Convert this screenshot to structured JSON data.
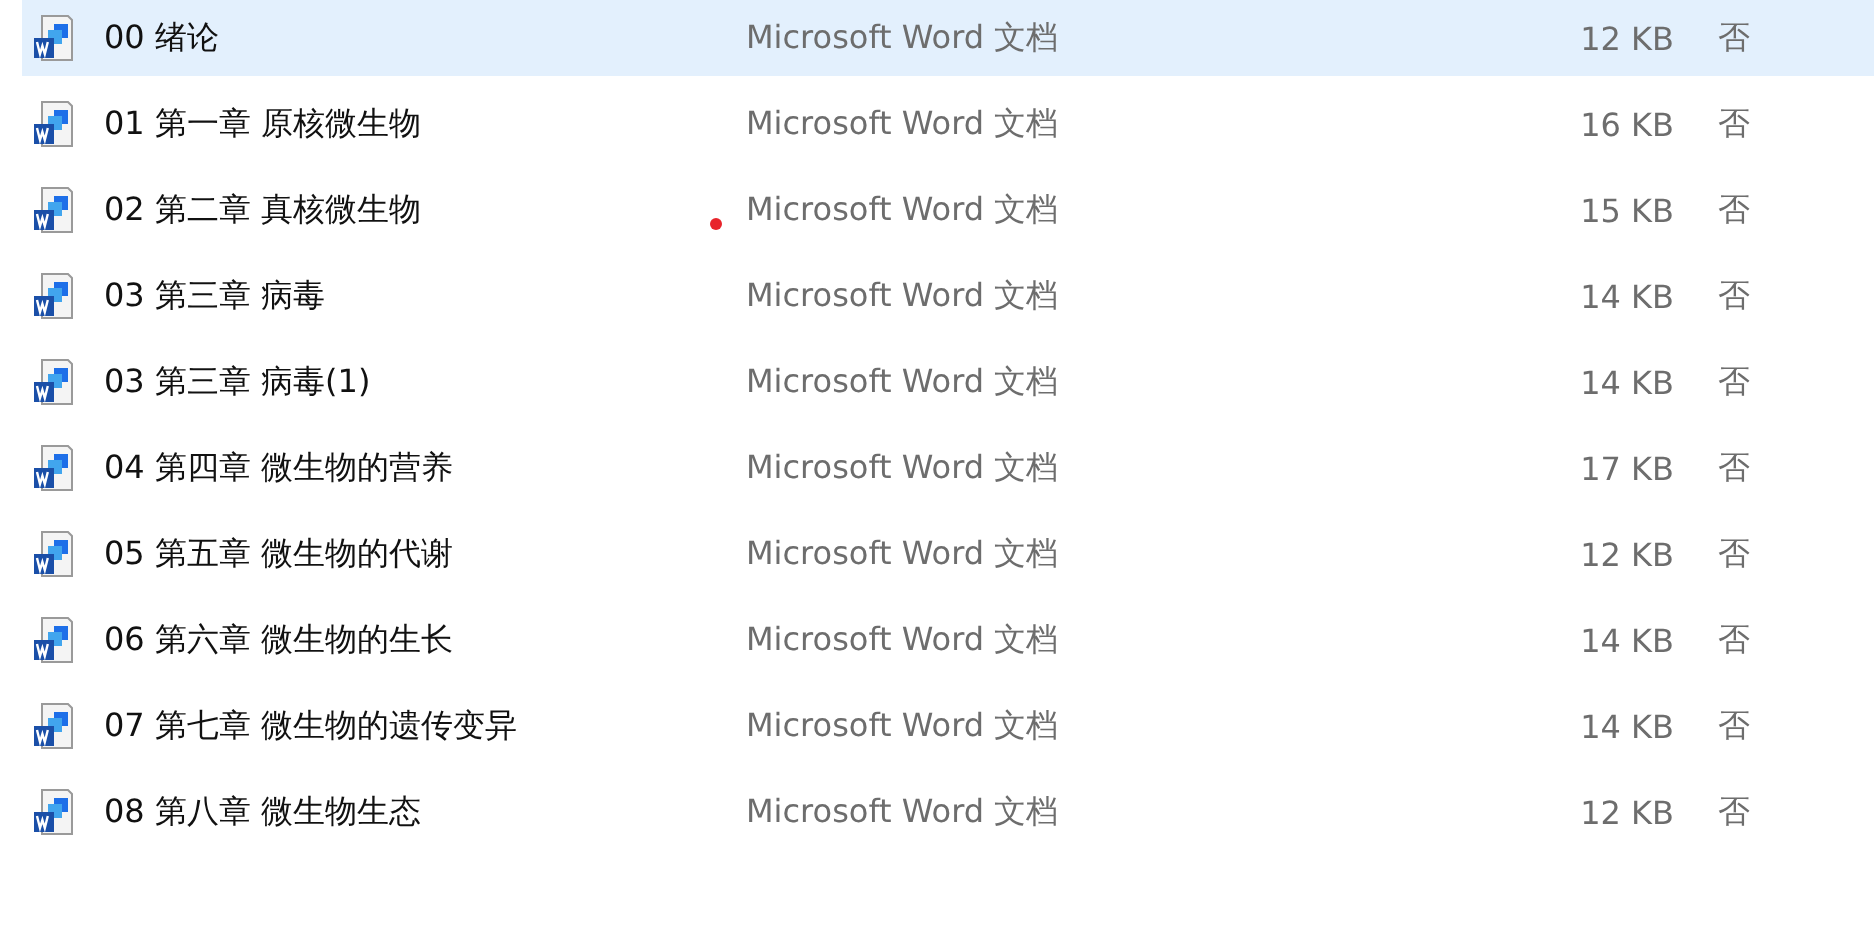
{
  "files": [
    {
      "name": "00 绪论",
      "type": "Microsoft Word 文档",
      "size": "12 KB",
      "column_4": "否",
      "selected": true
    },
    {
      "name": "01 第一章 原核微生物",
      "type": "Microsoft Word 文档",
      "size": "16 KB",
      "column_4": "否",
      "selected": false
    },
    {
      "name": "02 第二章 真核微生物",
      "type": "Microsoft Word 文档",
      "size": "15 KB",
      "column_4": "否",
      "selected": false
    },
    {
      "name": "03 第三章 病毒",
      "type": "Microsoft Word 文档",
      "size": "14 KB",
      "column_4": "否",
      "selected": false
    },
    {
      "name": "03 第三章 病毒(1)",
      "type": "Microsoft Word 文档",
      "size": "14 KB",
      "column_4": "否",
      "selected": false
    },
    {
      "name": "04 第四章 微生物的营养",
      "type": "Microsoft Word 文档",
      "size": "17 KB",
      "column_4": "否",
      "selected": false
    },
    {
      "name": "05 第五章 微生物的代谢",
      "type": "Microsoft Word 文档",
      "size": "12 KB",
      "column_4": "否",
      "selected": false
    },
    {
      "name": "06 第六章 微生物的生长",
      "type": "Microsoft Word 文档",
      "size": "14 KB",
      "column_4": "否",
      "selected": false
    },
    {
      "name": "07 第七章 微生物的遗传变异",
      "type": "Microsoft Word 文档",
      "size": "14 KB",
      "column_4": "否",
      "selected": false
    },
    {
      "name": "08 第八章 微生物生态",
      "type": "Microsoft Word 文档",
      "size": "12 KB",
      "column_4": "否",
      "selected": false
    }
  ]
}
